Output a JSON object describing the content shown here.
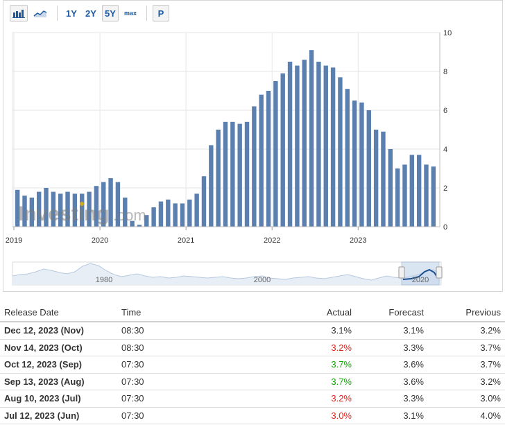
{
  "toolbar": {
    "bar_chart_icon": "bar-chart-icon",
    "area_chart_icon": "area-chart-icon",
    "ranges": [
      "1Y",
      "2Y",
      "5Y",
      "max"
    ],
    "active_range": "5Y",
    "print_label": "P"
  },
  "watermark": {
    "brand": "Investing",
    "suffix": ".com"
  },
  "chart_data": {
    "type": "bar",
    "x_ticks": [
      "2019",
      "2020",
      "2021",
      "2022",
      "2023"
    ],
    "y_ticks": [
      "0",
      "2",
      "4",
      "6",
      "8",
      "10"
    ],
    "ylim": [
      0,
      10
    ],
    "y_axis_side": "right",
    "grid": true,
    "color": "#5b80b0",
    "series": [
      {
        "values": [
          1.9,
          1.6,
          1.5,
          1.8,
          2.0,
          1.8,
          1.7,
          1.8,
          1.7,
          1.7,
          1.8,
          2.1,
          2.3,
          2.5,
          2.3,
          1.5,
          0.3,
          0.1,
          0.6,
          1.0,
          1.3,
          1.4,
          1.2,
          1.2,
          1.4,
          1.7,
          2.6,
          4.2,
          5.0,
          5.4,
          5.4,
          5.3,
          5.4,
          6.2,
          6.8,
          7.0,
          7.5,
          7.9,
          8.5,
          8.3,
          8.6,
          9.1,
          8.5,
          8.3,
          8.2,
          7.7,
          7.1,
          6.5,
          6.4,
          6.0,
          5.0,
          4.9,
          4.0,
          3.0,
          3.2,
          3.7,
          3.7,
          3.2,
          3.1
        ]
      }
    ]
  },
  "navigator": {
    "labels": [
      "1980",
      "2000",
      "2020"
    ]
  },
  "table": {
    "headers": [
      "Release Date",
      "Time",
      "Actual",
      "Forecast",
      "Previous"
    ],
    "rows": [
      {
        "date": "Dec 12, 2023 (Nov)",
        "time": "08:30",
        "actual": "3.1%",
        "actual_color": "neutral",
        "forecast": "3.1%",
        "previous": "3.2%"
      },
      {
        "date": "Nov 14, 2023 (Oct)",
        "time": "08:30",
        "actual": "3.2%",
        "actual_color": "red",
        "forecast": "3.3%",
        "previous": "3.7%"
      },
      {
        "date": "Oct 12, 2023 (Sep)",
        "time": "07:30",
        "actual": "3.7%",
        "actual_color": "green",
        "forecast": "3.6%",
        "previous": "3.7%"
      },
      {
        "date": "Sep 13, 2023 (Aug)",
        "time": "07:30",
        "actual": "3.7%",
        "actual_color": "green",
        "forecast": "3.6%",
        "previous": "3.2%"
      },
      {
        "date": "Aug 10, 2023 (Jul)",
        "time": "07:30",
        "actual": "3.2%",
        "actual_color": "red",
        "forecast": "3.3%",
        "previous": "3.0%"
      },
      {
        "date": "Jul 12, 2023 (Jun)",
        "time": "07:30",
        "actual": "3.0%",
        "actual_color": "red",
        "forecast": "3.1%",
        "previous": "4.0%"
      }
    ]
  }
}
